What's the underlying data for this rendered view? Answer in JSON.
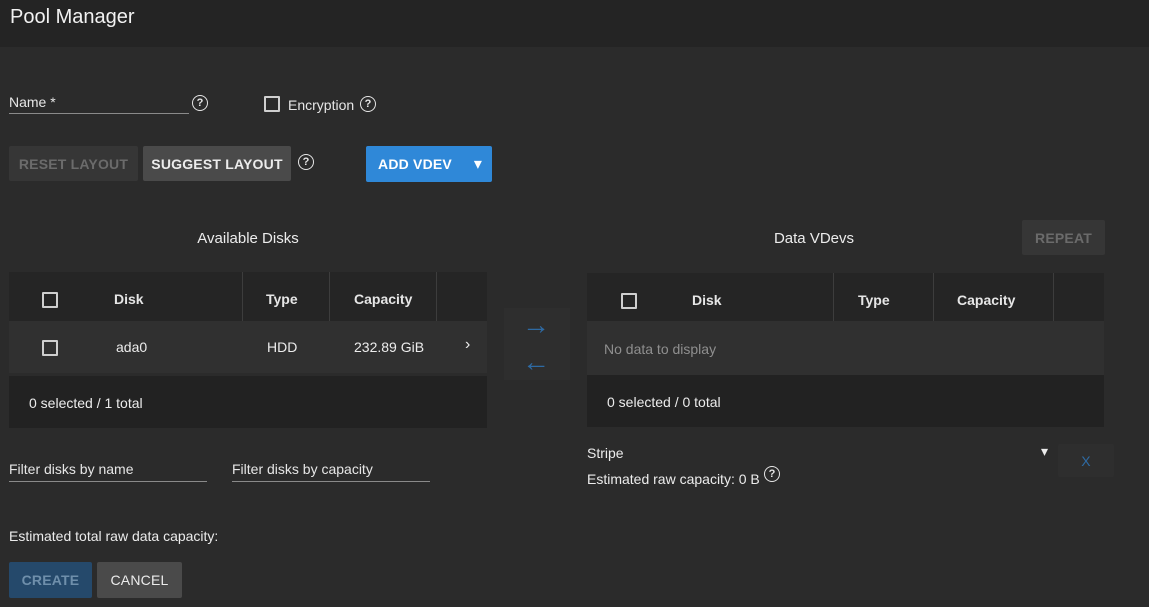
{
  "header": {
    "title": "Pool Manager"
  },
  "form": {
    "name_label": "Name *",
    "encryption_label": "Encryption",
    "help_glyph": "?"
  },
  "toolbar": {
    "reset_layout": "RESET LAYOUT",
    "suggest_layout": "SUGGEST LAYOUT",
    "add_vdev": "ADD VDEV",
    "dropdown_glyph": "▾"
  },
  "available": {
    "title": "Available Disks",
    "columns": [
      "Disk",
      "Type",
      "Capacity"
    ],
    "rows": [
      {
        "disk": "ada0",
        "type": "HDD",
        "capacity": "232.89 GiB",
        "expand": "›"
      }
    ],
    "footer": "0 selected / 1 total",
    "filter_name": "Filter disks by name",
    "filter_capacity": "Filter disks by capacity"
  },
  "transfer": {
    "right": "→",
    "left": "←"
  },
  "vdevs": {
    "title": "Data VDevs",
    "repeat": "REPEAT",
    "columns": [
      "Disk",
      "Type",
      "Capacity"
    ],
    "empty": "No data to display",
    "footer": "0 selected / 0 total",
    "layout": "Stripe",
    "layout_arrow": "▾",
    "estimated": "Estimated raw capacity: 0 B",
    "remove": "X"
  },
  "summary": {
    "estimated_total": "Estimated total raw data capacity:"
  },
  "actions": {
    "create": "CREATE",
    "cancel": "CANCEL"
  },
  "colors": {
    "accent": "#2f88d8",
    "accent_disabled": "#25496b",
    "background": "#2b2b2b"
  }
}
